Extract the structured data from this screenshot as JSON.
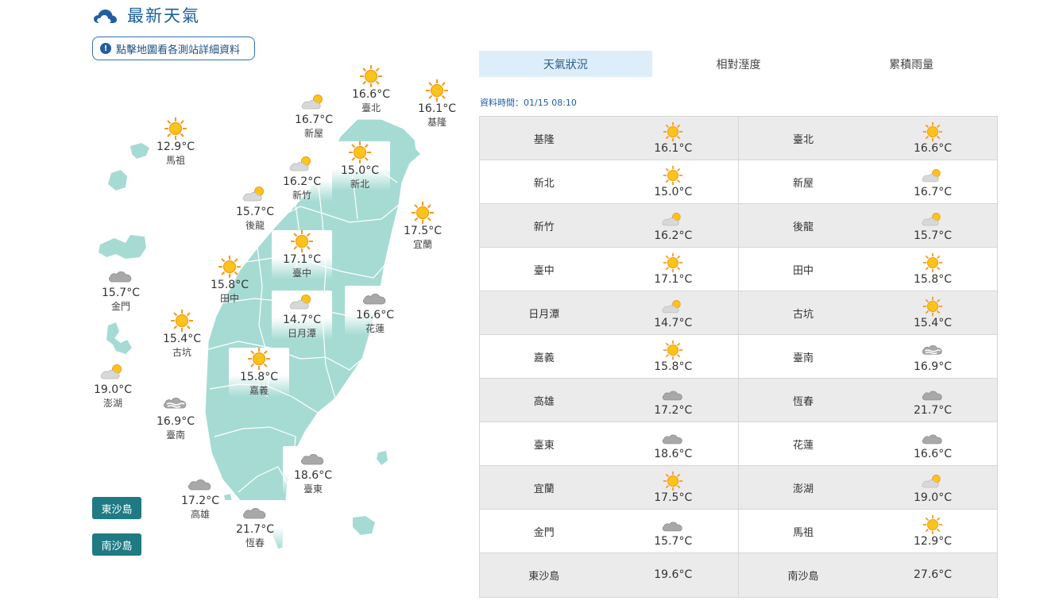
{
  "header": {
    "title": "最新天氣",
    "icon": "cloud-icon"
  },
  "info_button": {
    "label": "點擊地圖看各測站詳細資料",
    "icon": "info-icon"
  },
  "island_buttons": [
    {
      "label": "東沙島"
    },
    {
      "label": "南沙島"
    }
  ],
  "tabs": [
    {
      "label": "天氣狀況",
      "active": true
    },
    {
      "label": "相對溼度",
      "active": false
    },
    {
      "label": "累積雨量",
      "active": false
    }
  ],
  "datatime": "資料時間：01/15 08:10",
  "colors": {
    "land": "#a6dbd4",
    "accent": "#1f5ea6",
    "button": "#1f7a84",
    "tab_active": "#ddeefa"
  },
  "map_stations": [
    {
      "name": "馬祖",
      "temp": "12.9°C",
      "icon": "sunny-icon"
    },
    {
      "name": "新屋",
      "temp": "16.7°C",
      "icon": "partly-cloudy-icon"
    },
    {
      "name": "臺北",
      "temp": "16.6°C",
      "icon": "sunny-icon"
    },
    {
      "name": "基隆",
      "temp": "16.1°C",
      "icon": "sunny-icon"
    },
    {
      "name": "新竹",
      "temp": "16.2°C",
      "icon": "partly-cloudy-icon"
    },
    {
      "name": "新北",
      "temp": "15.0°C",
      "icon": "sunny-icon"
    },
    {
      "name": "後龍",
      "temp": "15.7°C",
      "icon": "partly-cloudy-icon"
    },
    {
      "name": "宜蘭",
      "temp": "17.5°C",
      "icon": "sunny-icon"
    },
    {
      "name": "臺中",
      "temp": "17.1°C",
      "icon": "sunny-icon"
    },
    {
      "name": "金門",
      "temp": "15.7°C",
      "icon": "cloudy-icon"
    },
    {
      "name": "田中",
      "temp": "15.8°C",
      "icon": "sunny-icon"
    },
    {
      "name": "日月潭",
      "temp": "14.7°C",
      "icon": "partly-cloudy-icon"
    },
    {
      "name": "花蓮",
      "temp": "16.6°C",
      "icon": "cloudy-icon"
    },
    {
      "name": "古坑",
      "temp": "15.4°C",
      "icon": "sunny-icon"
    },
    {
      "name": "嘉義",
      "temp": "15.8°C",
      "icon": "sunny-icon"
    },
    {
      "name": "澎湖",
      "temp": "19.0°C",
      "icon": "partly-cloudy-icon"
    },
    {
      "name": "臺南",
      "temp": "16.9°C",
      "icon": "foggy-cloud-icon"
    },
    {
      "name": "臺東",
      "temp": "18.6°C",
      "icon": "cloudy-icon"
    },
    {
      "name": "高雄",
      "temp": "17.2°C",
      "icon": "cloudy-icon"
    },
    {
      "name": "恆春",
      "temp": "21.7°C",
      "icon": "cloudy-icon"
    }
  ],
  "table_rows": [
    [
      {
        "name": "基隆",
        "temp": "16.1°C",
        "icon": "sunny-icon"
      },
      {
        "name": "臺北",
        "temp": "16.6°C",
        "icon": "sunny-icon"
      }
    ],
    [
      {
        "name": "新北",
        "temp": "15.0°C",
        "icon": "sunny-icon"
      },
      {
        "name": "新屋",
        "temp": "16.7°C",
        "icon": "partly-cloudy-icon"
      }
    ],
    [
      {
        "name": "新竹",
        "temp": "16.2°C",
        "icon": "partly-cloudy-icon"
      },
      {
        "name": "後龍",
        "temp": "15.7°C",
        "icon": "partly-cloudy-icon"
      }
    ],
    [
      {
        "name": "臺中",
        "temp": "17.1°C",
        "icon": "sunny-icon"
      },
      {
        "name": "田中",
        "temp": "15.8°C",
        "icon": "sunny-icon"
      }
    ],
    [
      {
        "name": "日月潭",
        "temp": "14.7°C",
        "icon": "partly-cloudy-icon"
      },
      {
        "name": "古坑",
        "temp": "15.4°C",
        "icon": "sunny-icon"
      }
    ],
    [
      {
        "name": "嘉義",
        "temp": "15.8°C",
        "icon": "sunny-icon"
      },
      {
        "name": "臺南",
        "temp": "16.9°C",
        "icon": "foggy-cloud-icon"
      }
    ],
    [
      {
        "name": "高雄",
        "temp": "17.2°C",
        "icon": "cloudy-icon"
      },
      {
        "name": "恆春",
        "temp": "21.7°C",
        "icon": "cloudy-icon"
      }
    ],
    [
      {
        "name": "臺東",
        "temp": "18.6°C",
        "icon": "cloudy-icon"
      },
      {
        "name": "花蓮",
        "temp": "16.6°C",
        "icon": "cloudy-icon"
      }
    ],
    [
      {
        "name": "宜蘭",
        "temp": "17.5°C",
        "icon": "sunny-icon"
      },
      {
        "name": "澎湖",
        "temp": "19.0°C",
        "icon": "partly-cloudy-icon"
      }
    ],
    [
      {
        "name": "金門",
        "temp": "15.7°C",
        "icon": "cloudy-icon"
      },
      {
        "name": "馬祖",
        "temp": "12.9°C",
        "icon": "sunny-icon"
      }
    ],
    [
      {
        "name": "東沙島",
        "temp": "19.6°C",
        "icon": ""
      },
      {
        "name": "南沙島",
        "temp": "27.6°C",
        "icon": ""
      }
    ]
  ]
}
